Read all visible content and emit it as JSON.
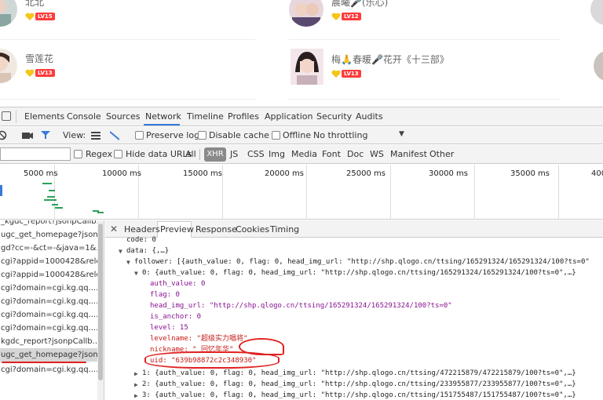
{
  "webpage": {
    "users": [
      {
        "name": "北北",
        "level": "LV15"
      },
      {
        "name": "雪莲花",
        "level": "LV13"
      },
      {
        "name": "晨曦🎤(乐心)",
        "level": "LV12"
      },
      {
        "name": "梅🙏春暖🎤花开《十三部》",
        "level": "LV13"
      }
    ]
  },
  "devtools": {
    "tabs": [
      "Elements",
      "Console",
      "Sources",
      "Network",
      "Timeline",
      "Profiles",
      "Application",
      "Security",
      "Audits"
    ],
    "active_tab": "Network",
    "toolbar": {
      "view_label": "View:",
      "preserve_log": "Preserve log",
      "disable_cache": "Disable cache",
      "offline": "Offline",
      "throttling": "No throttling"
    },
    "filter": {
      "regex": "Regex",
      "hide_data_urls": "Hide data URLs",
      "types": [
        "All",
        "XHR",
        "JS",
        "CSS",
        "Img",
        "Media",
        "Font",
        "Doc",
        "WS",
        "Manifest",
        "Other"
      ],
      "active_type": "XHR"
    },
    "overview_ticks": [
      "5000 ms",
      "10000 ms",
      "15000 ms",
      "20000 ms",
      "25000 ms",
      "30000 ms",
      "35000 ms",
      "400"
    ],
    "requests": [
      "_kgdc_report?jsonpCallb...",
      "ugc_get_homepage?json...",
      "gd?cc=-&ct=-&java=1&...",
      "cgi?appid=1000428&rele...",
      "cgi?appid=1000428&rele...",
      "cgi?domain=cgi.kg.qq....",
      "cgi?domain=cgi.kg.qq....",
      "cgi?domain=cgi.kg.qq....",
      "cgi?domain=cgi.kg.qq....",
      "kgdc_report?jsonpCallb...",
      "ugc_get_homepage?json...",
      "cgi?domain=cgi.kg.qq...."
    ],
    "selected_request_index": 10,
    "detail_tabs": [
      "Headers",
      "Preview",
      "Response",
      "Cookies",
      "Timing"
    ],
    "active_detail_tab": "Preview",
    "preview": {
      "code_line": "code: 0",
      "data_line": "data: {,…}",
      "follower_line": "follower: [{auth_value: 0, flag: 0, head_img_url: \"http://shp.qlogo.cn/ttsing/165291324/165291324/100?ts=0\"",
      "item0_line": "0: {auth_value: 0, flag: 0, head_img_url: \"http://shp.qlogo.cn/ttsing/165291324/165291324/100?ts=0\",…}",
      "auth_value": "auth_value: 0",
      "flag": "flag: 0",
      "head_img_url": "head_img_url: \"http://shp.qlogo.cn/ttsing/165291324/165291324/100?ts=0\"",
      "is_anchor": "is_anchor: 0",
      "level": "level: 15",
      "levelname": "levelname: \"超级实力唱将\"",
      "nickname": "nickname: \" 回忆年华\"",
      "uid": "uid: \"639b98872c2c348930\"",
      "item1_line": "1: {auth_value: 0, flag: 0, head_img_url: \"http://shp.qlogo.cn/ttsing/472215879/472215879/100?ts=0\",…}",
      "item2_line": "2: {auth_value: 0, flag: 0, head_img_url: \"http://shp.qlogo.cn/ttsing/233955877/233955877/100?ts=0\",…}",
      "item3_line": "3: {auth_value: 0, flag: 0, head_img_url: \"http://shp.qlogo.cn/ttsing/151755487/151755487/100?ts=0\",…}"
    }
  },
  "colors": {
    "accent": "#3879d9",
    "level_badge": "#ff3b3b",
    "annotation": "#e02020"
  }
}
